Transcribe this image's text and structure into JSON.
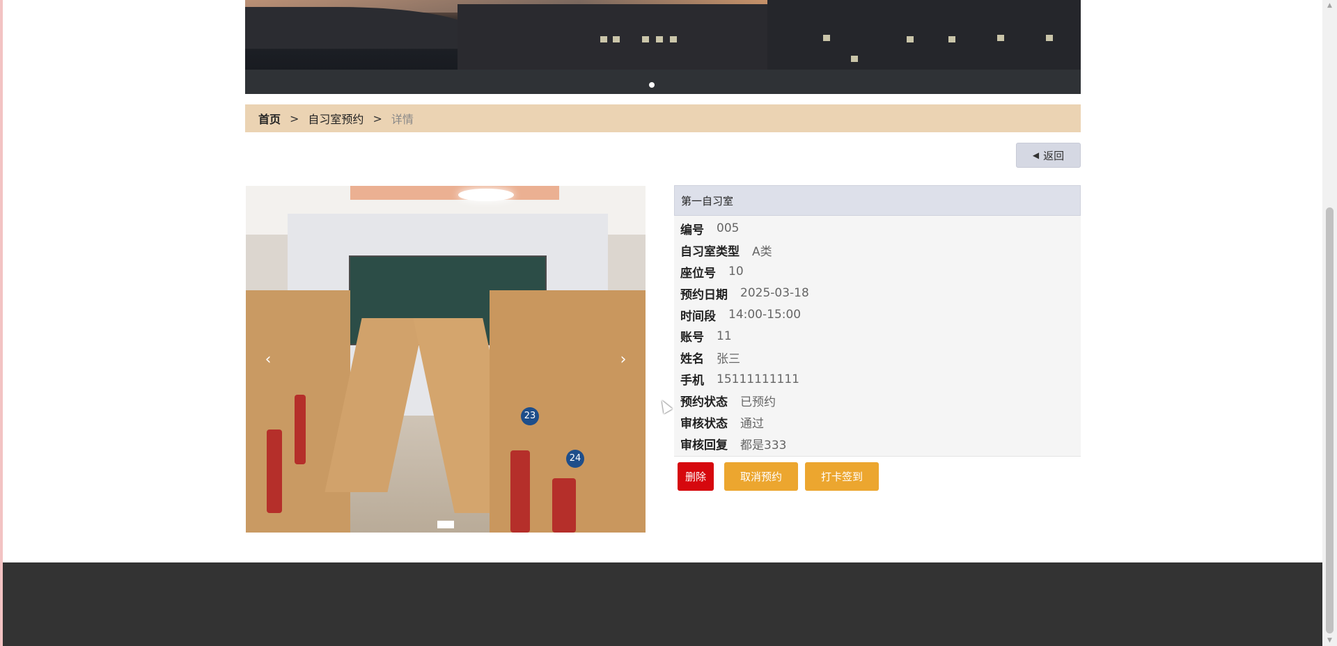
{
  "breadcrumb": {
    "home": "首页",
    "separator": ">",
    "section": "自习室预约",
    "current": "详情"
  },
  "back_button": {
    "label": "返回"
  },
  "gallery": {
    "prev_icon": "chevron-left-icon",
    "next_icon": "chevron-right-icon",
    "seat_numbers": [
      "23",
      "24"
    ]
  },
  "detail": {
    "title": "第一自习室",
    "fields": [
      {
        "label": "编号",
        "value": "005"
      },
      {
        "label": "自习室类型",
        "value": "A类"
      },
      {
        "label": "座位号",
        "value": "10"
      },
      {
        "label": "预约日期",
        "value": "2025-03-18"
      },
      {
        "label": "时间段",
        "value": "14:00-15:00"
      },
      {
        "label": "账号",
        "value": "11"
      },
      {
        "label": "姓名",
        "value": "张三"
      },
      {
        "label": "手机",
        "value": "15111111111"
      },
      {
        "label": "预约状态",
        "value": "已预约"
      },
      {
        "label": "审核状态",
        "value": "通过"
      },
      {
        "label": "审核回复",
        "value": "都是333"
      }
    ]
  },
  "actions": {
    "delete_label": "删除",
    "cancel_label": "取消预约",
    "checkin_label": "打卡签到"
  },
  "colors": {
    "breadcrumb_bg": "#ebd3b3",
    "delete": "#d6080e",
    "accent": "#eca62f",
    "footer": "#333333"
  }
}
